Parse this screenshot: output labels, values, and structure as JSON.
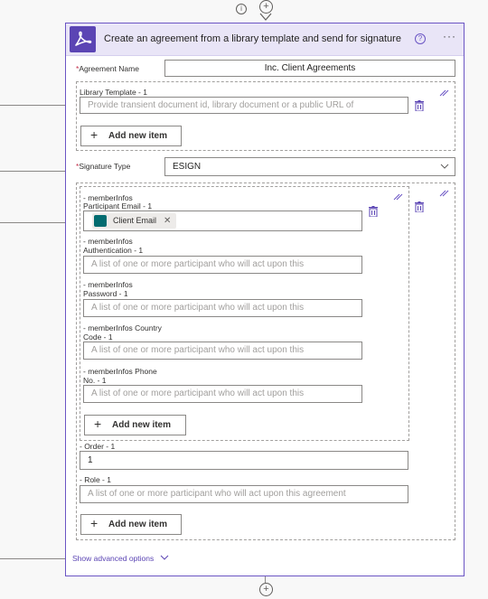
{
  "header": {
    "title": "Create an agreement from a library template and send for signature",
    "help_icon_glyph": "?",
    "more_icon_glyph": "···"
  },
  "fields": {
    "agreement_name": {
      "label": "Agreement Name",
      "required_mark": "*",
      "value": "Inc. Client Agreements"
    },
    "library_template": {
      "label": "Library Template - 1",
      "placeholder": "Provide transient document id, library document or a public URL of"
    },
    "signature_type": {
      "label": "Signature Type",
      "required_mark": "*",
      "value": "ESIGN"
    },
    "member_infos": {
      "participant_email": {
        "group": "- memberInfos",
        "label": "Participant Email - 1",
        "token": "Client Email"
      },
      "authentication": {
        "group": "- memberInfos",
        "label": "Authentication - 1",
        "placeholder": "A list of one or more participant who will act upon this"
      },
      "password": {
        "group": "- memberInfos",
        "label": "Password - 1",
        "placeholder": "A list of one or more participant who will act upon this"
      },
      "country_code": {
        "group": "- memberInfos Country",
        "label": "Code - 1",
        "placeholder": "A list of one or more participant who will act upon this"
      },
      "phone": {
        "group": "- memberInfos Phone",
        "label": "No. - 1",
        "placeholder": "A list of one or more participant who will act upon this"
      }
    },
    "order": {
      "label": "- Order - 1",
      "value": "1"
    },
    "role": {
      "label": "- Role - 1",
      "placeholder": "A list of one or more participant who will act upon this agreement"
    }
  },
  "buttons": {
    "add_new_item": "Add new item",
    "plus_glyph": "+"
  },
  "advanced": {
    "label": "Show advanced options"
  },
  "token_close_glyph": "✕",
  "top_info_glyph": "i",
  "flow_plus_glyph": "+",
  "colors": {
    "accent": "#6b55c4",
    "header_bg": "#e9e5f7",
    "token_icon": "#036c70",
    "required": "#c4314b"
  }
}
